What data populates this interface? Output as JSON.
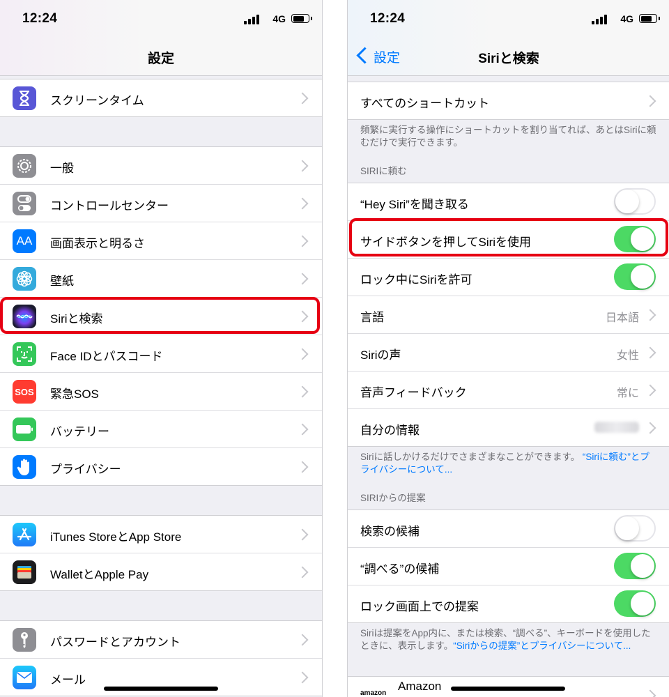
{
  "status": {
    "time": "12:24",
    "network": "4G"
  },
  "left": {
    "title": "設定",
    "groups": [
      [
        {
          "label": "スクリーンタイム",
          "icon": "hourglass-icon"
        }
      ],
      [
        {
          "label": "一般",
          "icon": "gear-icon"
        },
        {
          "label": "コントロールセンター",
          "icon": "toggles-icon"
        },
        {
          "label": "画面表示と明るさ",
          "icon": "text-size-icon"
        },
        {
          "label": "壁紙",
          "icon": "flower-icon"
        },
        {
          "label": "Siriと検索",
          "icon": "siri-icon"
        },
        {
          "label": "Face IDとパスコード",
          "icon": "face-id-icon"
        },
        {
          "label": "緊急SOS",
          "icon": "sos-icon"
        },
        {
          "label": "バッテリー",
          "icon": "battery-icon"
        },
        {
          "label": "プライバシー",
          "icon": "hand-icon"
        }
      ],
      [
        {
          "label": "iTunes StoreとApp Store",
          "icon": "app-store-icon"
        },
        {
          "label": "WalletとApple Pay",
          "icon": "wallet-icon"
        }
      ],
      [
        {
          "label": "パスワードとアカウント",
          "icon": "key-icon"
        },
        {
          "label": "メール",
          "icon": "mail-icon"
        }
      ]
    ],
    "icon_text": {
      "text_size": "AA",
      "sos": "SOS"
    }
  },
  "right": {
    "back_label": "設定",
    "title": "Siriと検索",
    "shortcuts_label": "すべてのショートカット",
    "shortcuts_footer": "頻繁に実行する操作にショートカットを割り当てれば、あとはSiriに頼むだけで実行できます。",
    "section1_header": "SIRIに頼む",
    "section1": [
      {
        "label": "“Hey Siri”を聞き取る",
        "toggle": false
      },
      {
        "label": "サイドボタンを押してSiriを使用",
        "toggle": true
      },
      {
        "label": "ロック中にSiriを許可",
        "toggle": true
      },
      {
        "label": "言語",
        "value": "日本語"
      },
      {
        "label": "Siriの声",
        "value": "女性"
      },
      {
        "label": "音声フィードバック",
        "value": "常に"
      },
      {
        "label": "自分の情報",
        "value": ""
      }
    ],
    "section1_footer": "Siriに話しかけるだけでさまざまなことができます。",
    "section1_footer_link": "“Siriに頼む”とプライバシーについて...",
    "section2_header": "SIRIからの提案",
    "section2": [
      {
        "label": "検索の候補",
        "toggle": false
      },
      {
        "label": "“調べる”の候補",
        "toggle": true
      },
      {
        "label": "ロック画面上での提案",
        "toggle": true
      }
    ],
    "section2_footer": "Siriは提案をApp内に、または検索、“調べる”、キーボードを使用したときに、表示します。",
    "section2_footer_link": "“Siriからの提案”とプライバシーについて...",
    "app_row": {
      "label": "Amazon",
      "logo_text": "amazon"
    }
  },
  "colors": {
    "toggle_on": "#4cd964",
    "link": "#007aff",
    "highlight": "#e60012"
  }
}
